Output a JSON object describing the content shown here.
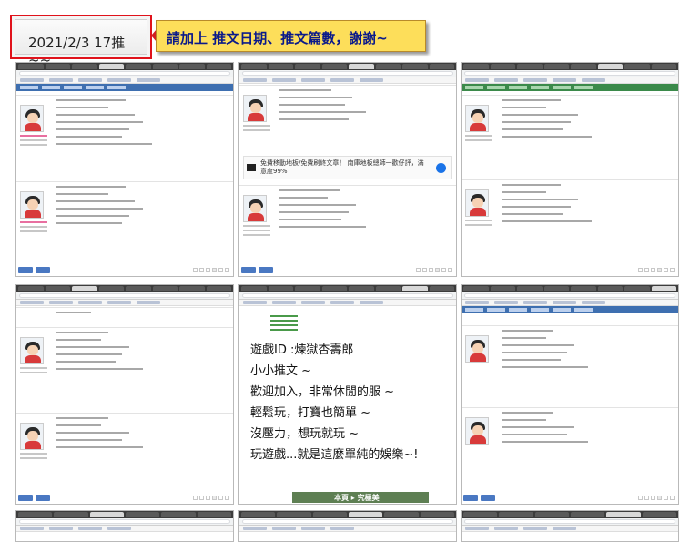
{
  "header": {
    "date_label": "2021/2/3 17推~~",
    "note": "請加上 推文日期、推文篇數，謝謝~"
  },
  "zoomed_post": {
    "lines": [
      "遊戲ID :煉獄杏壽郎",
      "小小推文 ~",
      "歡迎加入，非常休閒的服 ~",
      "輕鬆玩，打寶也簡單 ~",
      "沒壓力，想玩就玩 ~",
      "玩遊戲...就是這麼單純的娛樂~!"
    ],
    "banner_label": "本頁 ▸ 究極美"
  },
  "ad": {
    "text": "免費移動地板/免費刷終文章！ 南庫地板總師一歡仔評，滿意度99%"
  },
  "colors": {
    "annotation_border": "#e0121b",
    "note_background": "#fdde5a",
    "note_text": "#0b1a8a",
    "forum_green": "#3b8a4a",
    "forum_blue": "#3e6fb0",
    "button_blue": "#4a78c2"
  }
}
